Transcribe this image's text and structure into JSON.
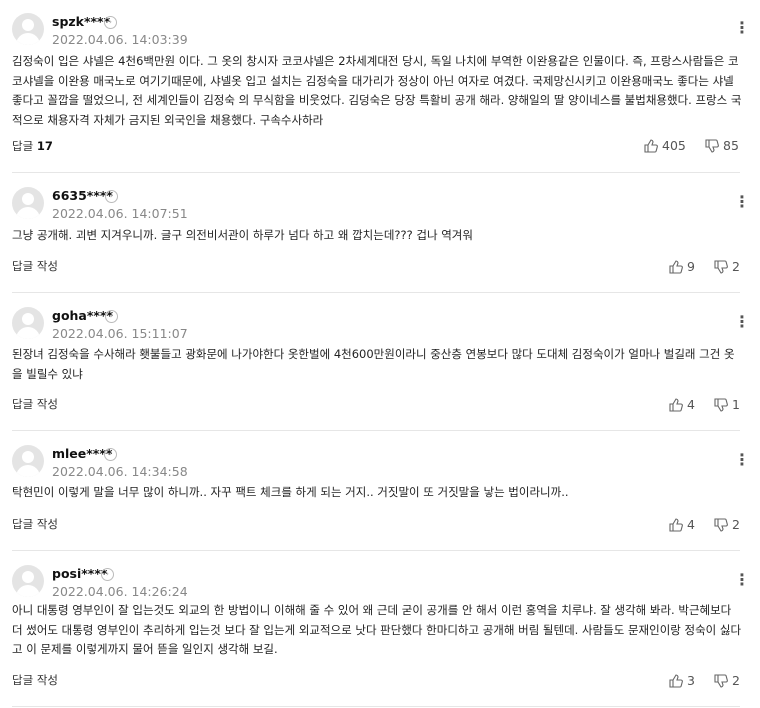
{
  "reply_label": "답글",
  "write_label": "답글 작성",
  "comments": [
    {
      "nick": "spzk****",
      "date": "2022.04.06. 14:03:39",
      "text": "김정숙이 입은 샤넬은 4천6백만원 이다. 그 옷의 창시자 코코샤넬은 2차세계대전 당시, 독일 나치에 부역한 이완용같은 인물이다. 즉, 프랑스사람들은 코코샤넬을 이완용 매국노로 여기기때문에, 샤넬옷 입고 설치는 김정숙을 대가리가 정상이 아닌 여자로 여겼다. 국제망신시키고 이완용매국노 좋다는 샤넬 좋다고 꼴깝을 떨었으니, 전 세계인들이 김정숙 의 무식함을 비웃었다. 김덩숙은 당장 특활비 공개 해라. 양해일의 딸 양이네스를 불법채용했다. 프랑스 국적으로 채용자격 자체가 금지된 외국인을 채용했다. 구속수사하라",
      "reply_count": "17",
      "likes": "405",
      "dislikes": "85"
    },
    {
      "nick": "6635****",
      "date": "2022.04.06. 14:07:51",
      "text": "그냥 공개해. 괴변 지겨우니까. 글구 의전비서관이 하루가 넘다 하고 왜 깝치는데??? 겁나 역겨워",
      "reply_count": "",
      "likes": "9",
      "dislikes": "2"
    },
    {
      "nick": "goha****",
      "date": "2022.04.06. 15:11:07",
      "text": "된장녀 김정숙을 수사해라 횃불들고 광화문에 나가야한다 옷한벌에 4천600만원이라니 중산층 연봉보다 많다 도대체 김정숙이가 얼마나 벌길래 그건 옷을 빌릴수 있냐",
      "reply_count": "",
      "likes": "4",
      "dislikes": "1"
    },
    {
      "nick": "mlee****",
      "date": "2022.04.06. 14:34:58",
      "text": "탁현민이 이렇게 말을 너무 많이 하니까.. 자꾸 팩트 체크를 하게 되는 거지.. 거짓말이 또 거짓말을 낳는 법이라니까..",
      "reply_count": "",
      "likes": "4",
      "dislikes": "2"
    },
    {
      "nick": "posi****",
      "date": "2022.04.06. 14:26:24",
      "text": "아니 대통령 영부인이 잘 입는것도 외교의 한 방법이니 이해해 줄 수 있어 왜 근데 굳이 공개를 안 해서 이런 홍역을 치루냐. 잘 생각해 봐라. 박근혜보다 더 썼어도 대통령 영부인이 추리하게 입는것 보다 잘 입는게 외교적으로 낫다 판단했다 한마디하고 공개해 버림 될텐데. 사람들도 문재인이랑 정숙이 싫다고 이 문제를 이렇게까지 물어 뜯을 일인지 생각해 보길.",
      "reply_count": "",
      "likes": "3",
      "dislikes": "2"
    }
  ]
}
